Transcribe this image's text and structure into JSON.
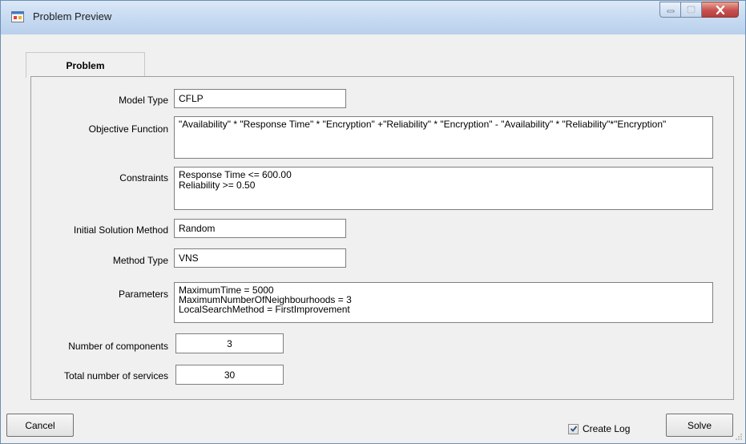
{
  "window": {
    "title": "Problem Preview"
  },
  "tabs": [
    {
      "label": "Problem"
    }
  ],
  "form": {
    "model_type": {
      "label": "Model Type",
      "value": "CFLP"
    },
    "objective_function": {
      "label": "Objective Function",
      "value": "\"Availability\" * \"Response Time\" * \"Encryption\" +\"Reliability\" * \"Encryption\" - \"Availability\" * \"Reliability\"*\"Encryption\""
    },
    "constraints": {
      "label": "Constraints",
      "lines": [
        "Response Time <= 600.00",
        "Reliability >= 0.50"
      ]
    },
    "initial_solution_method": {
      "label": "Initial Solution Method",
      "value": "Random"
    },
    "method_type": {
      "label": "Method Type",
      "value": "VNS"
    },
    "parameters": {
      "label": "Parameters",
      "lines": [
        "MaximumTime = 5000",
        "MaximumNumberOfNeighbourhoods = 3",
        "LocalSearchMethod = FirstImprovement"
      ]
    },
    "number_of_components": {
      "label": "Number of components",
      "value": "3"
    },
    "total_number_of_services": {
      "label": "Total number of services",
      "value": "30"
    }
  },
  "footer": {
    "cancel_label": "Cancel",
    "create_log_label": "Create Log",
    "create_log_checked": true,
    "solve_label": "Solve"
  },
  "colors": {
    "title_bar": "#c9dcf2",
    "close_button": "#c75050",
    "client_background": "#f0f0f0"
  }
}
